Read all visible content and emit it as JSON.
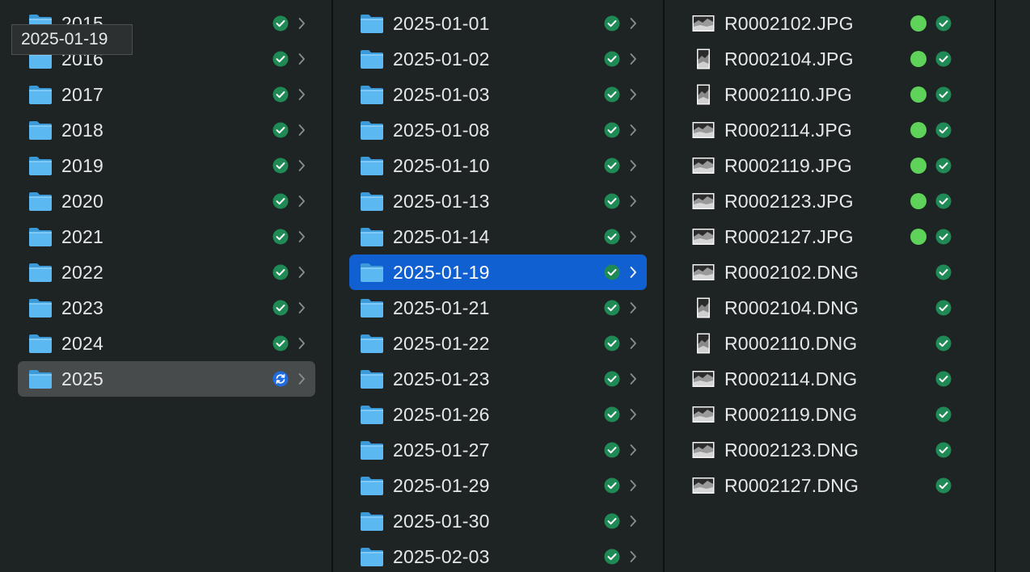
{
  "tooltip": {
    "text": "2025-01-19"
  },
  "years_column": {
    "items": [
      {
        "label": "2015",
        "status": "synced"
      },
      {
        "label": "2016",
        "status": "synced"
      },
      {
        "label": "2017",
        "status": "synced"
      },
      {
        "label": "2018",
        "status": "synced"
      },
      {
        "label": "2019",
        "status": "synced"
      },
      {
        "label": "2020",
        "status": "synced"
      },
      {
        "label": "2021",
        "status": "synced"
      },
      {
        "label": "2022",
        "status": "synced"
      },
      {
        "label": "2023",
        "status": "synced"
      },
      {
        "label": "2024",
        "status": "synced"
      },
      {
        "label": "2025",
        "status": "syncing",
        "highlighted": true
      }
    ]
  },
  "dates_column": {
    "items": [
      {
        "label": "2025-01-01",
        "status": "synced"
      },
      {
        "label": "2025-01-02",
        "status": "synced"
      },
      {
        "label": "2025-01-03",
        "status": "synced"
      },
      {
        "label": "2025-01-08",
        "status": "synced"
      },
      {
        "label": "2025-01-10",
        "status": "synced"
      },
      {
        "label": "2025-01-13",
        "status": "synced"
      },
      {
        "label": "2025-01-14",
        "status": "synced"
      },
      {
        "label": "2025-01-19",
        "status": "synced",
        "selected": true
      },
      {
        "label": "2025-01-21",
        "status": "synced"
      },
      {
        "label": "2025-01-22",
        "status": "synced"
      },
      {
        "label": "2025-01-23",
        "status": "synced"
      },
      {
        "label": "2025-01-26",
        "status": "synced"
      },
      {
        "label": "2025-01-27",
        "status": "synced"
      },
      {
        "label": "2025-01-29",
        "status": "synced"
      },
      {
        "label": "2025-01-30",
        "status": "synced"
      },
      {
        "label": "2025-02-03",
        "status": "synced"
      }
    ]
  },
  "files_column": {
    "items": [
      {
        "label": "R0002102.JPG",
        "tag": "green",
        "status": "synced",
        "thumb": "landscape-thumbnail-icon"
      },
      {
        "label": "R0002104.JPG",
        "tag": "green",
        "status": "synced",
        "thumb": "portrait-thumbnail-icon"
      },
      {
        "label": "R0002110.JPG",
        "tag": "green",
        "status": "synced",
        "thumb": "portrait-thumbnail-icon"
      },
      {
        "label": "R0002114.JPG",
        "tag": "green",
        "status": "synced",
        "thumb": "landscape-thumbnail-icon"
      },
      {
        "label": "R0002119.JPG",
        "tag": "green",
        "status": "synced",
        "thumb": "landscape-thumbnail-icon"
      },
      {
        "label": "R0002123.JPG",
        "tag": "green",
        "status": "synced",
        "thumb": "landscape-thumbnail-icon"
      },
      {
        "label": "R0002127.JPG",
        "tag": "green",
        "status": "synced",
        "thumb": "landscape-thumbnail-icon"
      },
      {
        "label": "R0002102.DNG",
        "tag": null,
        "status": "synced",
        "thumb": "landscape-thumbnail-icon"
      },
      {
        "label": "R0002104.DNG",
        "tag": null,
        "status": "synced",
        "thumb": "portrait-thumbnail-icon"
      },
      {
        "label": "R0002110.DNG",
        "tag": null,
        "status": "synced",
        "thumb": "portrait-thumbnail-icon"
      },
      {
        "label": "R0002114.DNG",
        "tag": null,
        "status": "synced",
        "thumb": "landscape-thumbnail-icon"
      },
      {
        "label": "R0002119.DNG",
        "tag": null,
        "status": "synced",
        "thumb": "landscape-thumbnail-icon"
      },
      {
        "label": "R0002123.DNG",
        "tag": null,
        "status": "synced",
        "thumb": "landscape-thumbnail-icon"
      },
      {
        "label": "R0002127.DNG",
        "tag": null,
        "status": "synced",
        "thumb": "landscape-thumbnail-icon"
      }
    ]
  },
  "colors": {
    "background": "#1e2424",
    "selection": "#1060d2",
    "highlight": "#484b4c",
    "synced_badge": "#1f8a55",
    "syncing_badge": "#1f6be0",
    "green_tag": "#5fd25a",
    "folder_blue": "#5cb8f0"
  }
}
